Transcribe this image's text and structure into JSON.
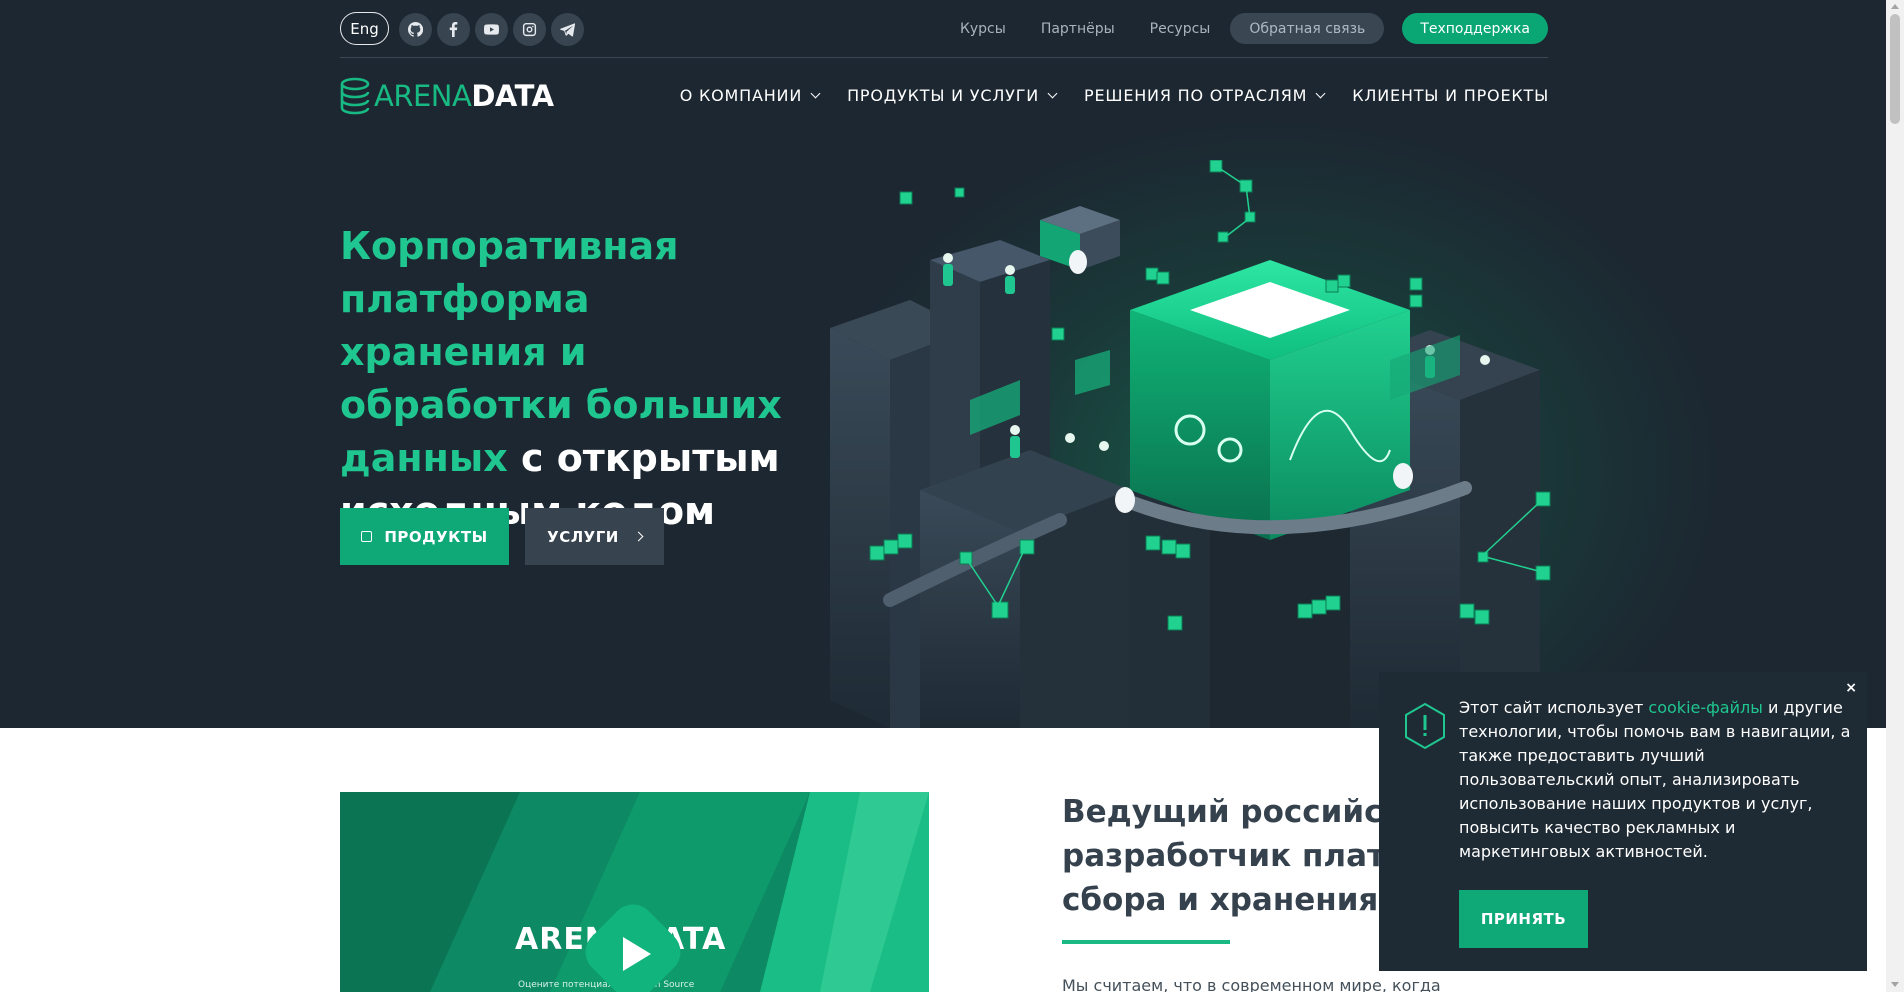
{
  "topbar": {
    "lang_label": "Eng",
    "social": [
      "github-icon",
      "facebook-icon",
      "youtube-icon",
      "instagram-icon",
      "telegram-icon"
    ],
    "links": [
      "Курсы",
      "Партнёры",
      "Ресурсы"
    ],
    "feedback_label": "Обратная связь",
    "support_label": "Техподдержка"
  },
  "logo": {
    "part1": "ARENA",
    "part2": "DATA"
  },
  "nav": {
    "items": [
      {
        "label": "О КОМПАНИИ",
        "has_dropdown": true
      },
      {
        "label": "ПРОДУКТЫ И УСЛУГИ",
        "has_dropdown": true
      },
      {
        "label": "РЕШЕНИЯ ПО ОТРАСЛЯМ",
        "has_dropdown": true
      },
      {
        "label": "КЛИЕНТЫ И ПРОЕКТЫ",
        "has_dropdown": false
      }
    ]
  },
  "hero": {
    "headline_accent": "Корпоративная платформа хранения и обработки больших данных",
    "headline_rest": " с открытым исходным кодом",
    "products_button": "ПРОДУКТЫ",
    "services_button": "УСЛУГИ"
  },
  "video": {
    "logo_text": "ARENADATA",
    "caption": "Оцените потенциал ... и Open Source"
  },
  "about": {
    "title": "Ведущий российский разработчик платформ сбора и хранения данных",
    "text": "Мы считаем, что в современном мире, когда"
  },
  "cookie": {
    "text_before": "Этот сайт использует ",
    "link": "cookie-файлы",
    "text_after": " и другие технологии, чтобы помочь вам в навигации, а также предоставить лучший пользовательский опыт, анализировать использование наших продуктов и услуг, повысить качество рекламных и маркетинговых активностей.",
    "accept_label": "ПРИНЯТЬ",
    "close_label": "×"
  },
  "colors": {
    "hero_bg": "#1c2731",
    "accent": "#0fa877",
    "accent_text": "#1fc68f",
    "cookie_bg": "#1f2b34"
  }
}
